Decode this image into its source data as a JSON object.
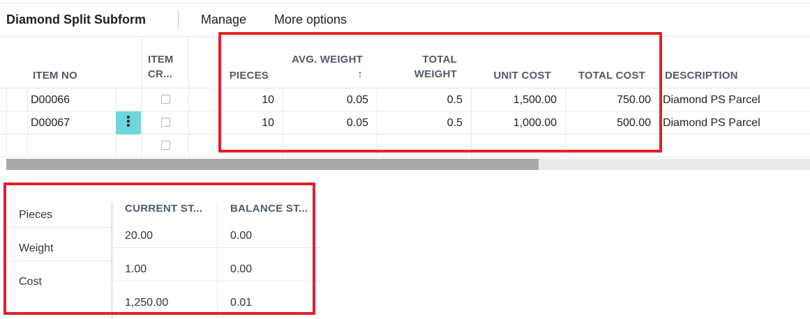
{
  "header": {
    "title": "Diamond Split Subform",
    "actions": [
      "Manage",
      "More options"
    ]
  },
  "grid": {
    "columns": {
      "item_no": "ITEM NO",
      "item_cr_line1": "ITEM",
      "item_cr_line2": "CR...",
      "pieces": "PIECES",
      "avg_weight_line1": "AVG. WEIGHT",
      "avg_weight_sort": "↑",
      "total_weight_line1": "TOTAL",
      "total_weight_line2": "WEIGHT",
      "unit_cost": "UNIT COST",
      "total_cost": "TOTAL COST",
      "description": "DESCRIPTION"
    },
    "rows": [
      {
        "item_no": "D00066",
        "pieces": "10",
        "avg_weight": "0.05",
        "total_weight": "0.5",
        "unit_cost": "1,500.00",
        "total_cost": "750.00",
        "description": "Diamond PS Parcel"
      },
      {
        "item_no": "D00067",
        "pieces": "10",
        "avg_weight": "0.05",
        "total_weight": "0.5",
        "unit_cost": "1,000.00",
        "total_cost": "500.00",
        "description": "Diamond PS Parcel"
      }
    ],
    "row_menu_glyph": "⋮"
  },
  "summary": {
    "labels": [
      "Pieces",
      "Weight",
      "Cost"
    ],
    "columns": [
      "CURRENT ST...",
      "BALANCE ST..."
    ],
    "current": [
      "20.00",
      "1.00",
      "1,250.00"
    ],
    "balance": [
      "0.00",
      "0.00",
      "0.01"
    ]
  },
  "colors": {
    "highlight_border": "#e3202b",
    "row_menu_bg": "#6fd6dc",
    "header_text": "#505a68"
  }
}
